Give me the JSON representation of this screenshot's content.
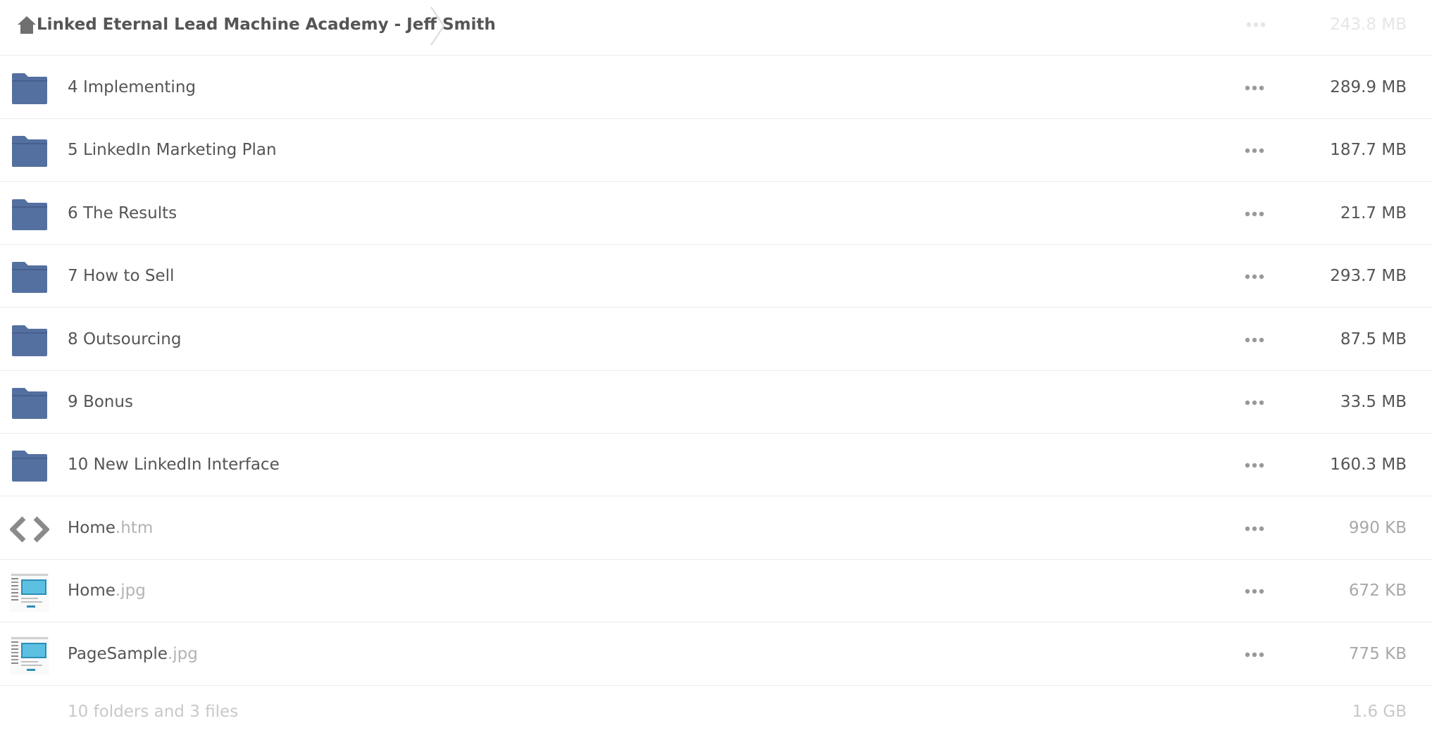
{
  "breadcrumb": {
    "home_icon": "home-icon",
    "title": "Linked Eternal Lead Machine Academy - Jeff Smith",
    "partial_size": "243.8 MB"
  },
  "items": [
    {
      "name": "4 Implementing",
      "ext": "",
      "size": "289.9 MB",
      "type": "folder",
      "icon": "folder-icon"
    },
    {
      "name": "5 LinkedIn Marketing Plan",
      "ext": "",
      "size": "187.7 MB",
      "type": "folder",
      "icon": "folder-icon"
    },
    {
      "name": "6 The Results",
      "ext": "",
      "size": "21.7 MB",
      "type": "folder",
      "icon": "folder-icon"
    },
    {
      "name": "7 How to Sell",
      "ext": "",
      "size": "293.7 MB",
      "type": "folder",
      "icon": "folder-icon"
    },
    {
      "name": "8 Outsourcing",
      "ext": "",
      "size": "87.5 MB",
      "type": "folder",
      "icon": "folder-icon"
    },
    {
      "name": "9 Bonus",
      "ext": "",
      "size": "33.5 MB",
      "type": "folder",
      "icon": "folder-icon"
    },
    {
      "name": "10 New LinkedIn Interface",
      "ext": "",
      "size": "160.3 MB",
      "type": "folder",
      "icon": "folder-icon"
    },
    {
      "name": "Home",
      "ext": ".htm",
      "size": "990 KB",
      "type": "file",
      "icon": "code-icon"
    },
    {
      "name": "Home",
      "ext": ".jpg",
      "size": "672 KB",
      "type": "file",
      "icon": "image-thumbnail"
    },
    {
      "name": "PageSample",
      "ext": ".jpg",
      "size": "775 KB",
      "type": "file",
      "icon": "image-thumbnail"
    }
  ],
  "summary": {
    "text": "10 folders and 3 files",
    "total": "1.6 GB"
  },
  "colors": {
    "folder": "#5470a0",
    "text": "#555555",
    "muted": "#b3b3b3",
    "divider": "#ececec"
  }
}
